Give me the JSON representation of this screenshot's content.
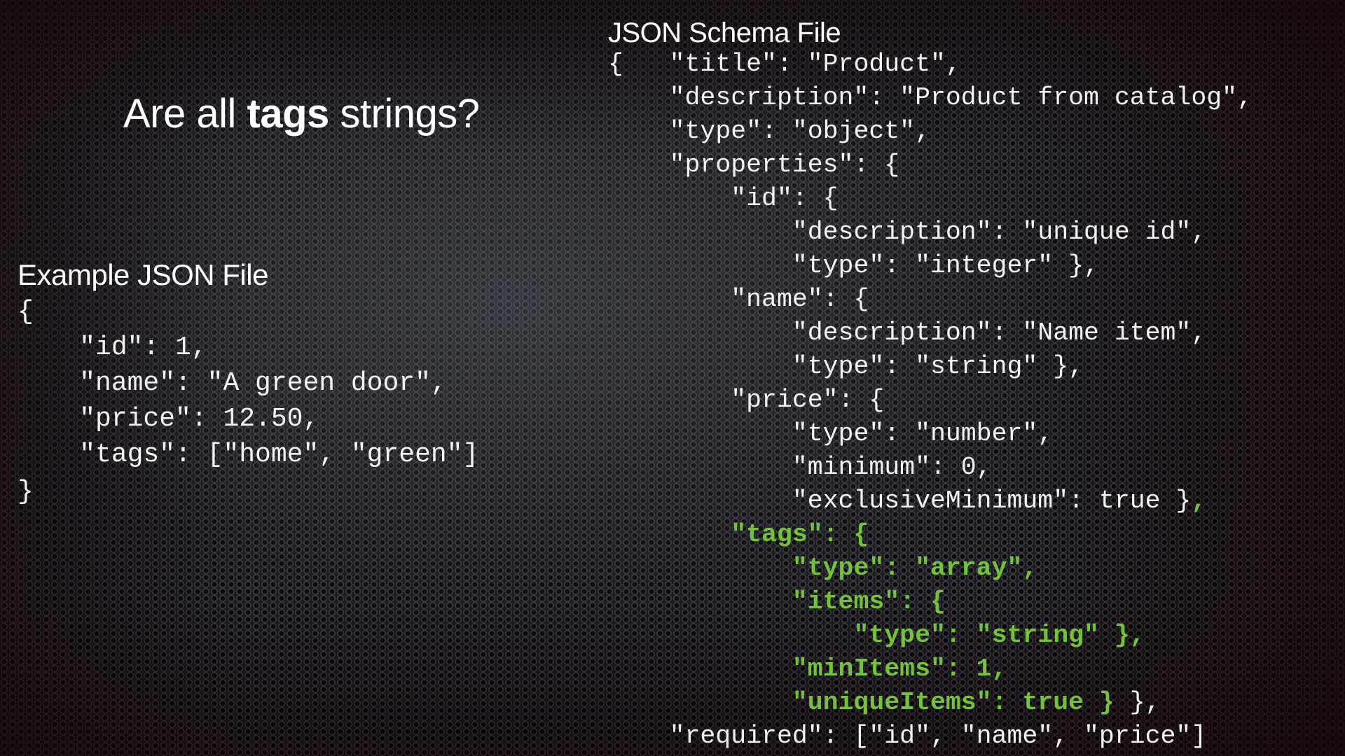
{
  "slide": {
    "question": {
      "prefix": "Are all ",
      "emphasis": "tags",
      "suffix": " strings?"
    },
    "example": {
      "heading": "Example JSON File",
      "lines": [
        "{",
        "    \"id\": 1,",
        "    \"name\": \"A green door\",",
        "    \"price\": 12.50,",
        "    \"tags\": [\"home\", \"green\"]",
        "}"
      ]
    },
    "schema": {
      "heading": "JSON Schema File",
      "lines": [
        {
          "text": "{   \"title\": \"Product\",",
          "highlight": false
        },
        {
          "text": "    \"description\": \"Product from catalog\",",
          "highlight": false
        },
        {
          "text": "    \"type\": \"object\",",
          "highlight": false
        },
        {
          "text": "    \"properties\": {",
          "highlight": false
        },
        {
          "text": "        \"id\": {",
          "highlight": false
        },
        {
          "text": "            \"description\": \"unique id\",",
          "highlight": false
        },
        {
          "text": "            \"type\": \"integer\" },",
          "highlight": false
        },
        {
          "text": "        \"name\": {",
          "highlight": false
        },
        {
          "text": "            \"description\": \"Name item\",",
          "highlight": false
        },
        {
          "text": "            \"type\": \"string\" },",
          "highlight": false
        },
        {
          "text": "        \"price\": {",
          "highlight": false
        },
        {
          "text": "            \"type\": \"number\",",
          "highlight": false
        },
        {
          "text": "            \"minimum\": 0,",
          "highlight": false
        },
        {
          "text": "            \"exclusiveMinimum\": true }",
          "tail": ",",
          "highlight": false,
          "tail_highlight": true
        },
        {
          "text": "        \"tags\": {",
          "highlight": true
        },
        {
          "text": "            \"type\": \"array\",",
          "highlight": true
        },
        {
          "text": "            \"items\": {",
          "highlight": true
        },
        {
          "text": "                \"type\": \"string\" },",
          "highlight": true
        },
        {
          "text": "            \"minItems\": 1,",
          "highlight": true
        },
        {
          "text": "            \"uniqueItems\": true }",
          "tail": " },",
          "highlight": true,
          "tail_highlight": false
        },
        {
          "text": "    \"required\": [\"id\", \"name\", \"price\"]",
          "highlight": false
        }
      ]
    },
    "colors": {
      "highlight": "#74c23a",
      "text": "#f2f2f2",
      "background": "#1a1a1e"
    }
  }
}
